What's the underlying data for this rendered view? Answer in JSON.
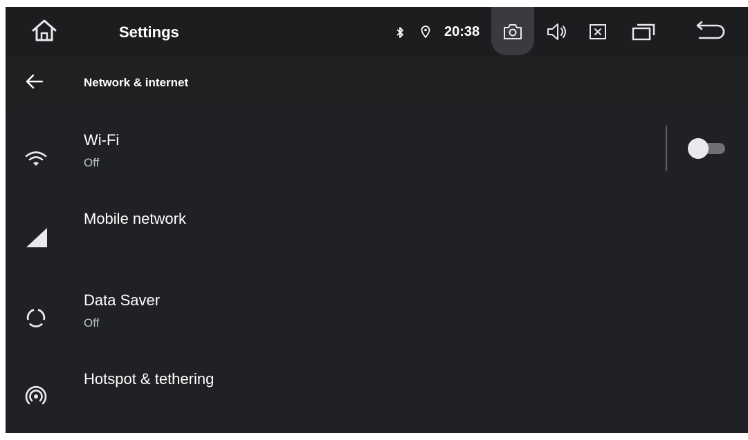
{
  "statusbar": {
    "app_title": "Settings",
    "clock": "20:38",
    "icons": [
      "home-icon",
      "bluetooth-icon",
      "location-icon",
      "screenshot-icon",
      "volume-icon",
      "close-window-icon",
      "recents-icon",
      "back-icon"
    ]
  },
  "toolbar": {
    "title": "Network & internet",
    "back_icon": "arrow-left-icon"
  },
  "items": [
    {
      "icon": "wifi-icon",
      "title": "Wi-Fi",
      "subtitle": "Off",
      "toggle": false
    },
    {
      "icon": "signal-icon",
      "title": "Mobile network"
    },
    {
      "icon": "data-saver-icon",
      "title": "Data Saver",
      "subtitle": "Off"
    },
    {
      "icon": "hotspot-icon",
      "title": "Hotspot & tethering"
    }
  ],
  "colors": {
    "background": "#202124",
    "text_primary": "#ffffff",
    "text_secondary": "#bdc1c6",
    "toggle_track": "#6f7176",
    "toggle_thumb": "#e8eaed"
  }
}
